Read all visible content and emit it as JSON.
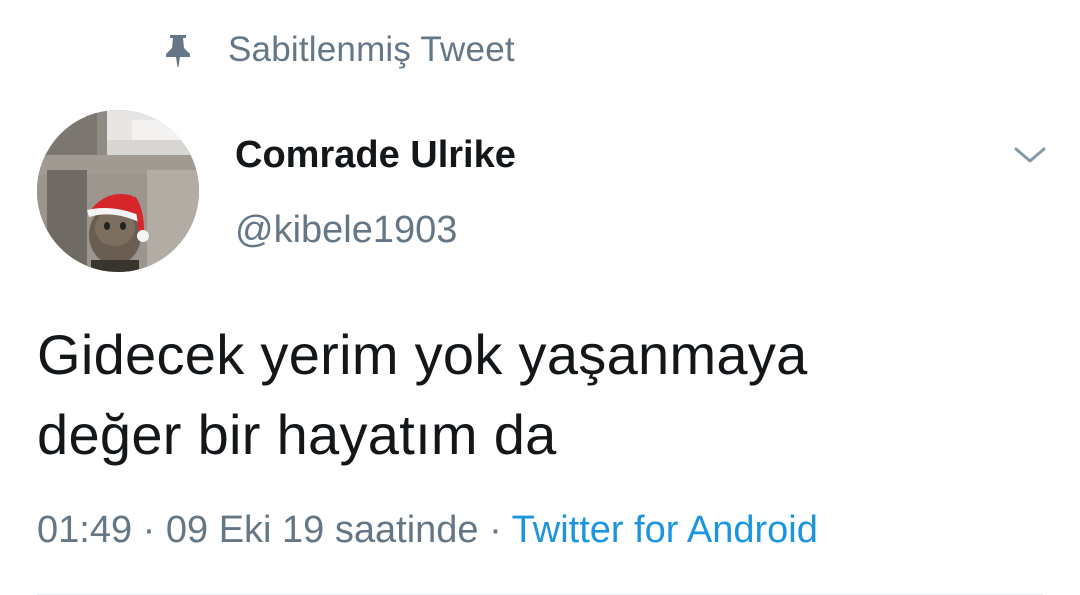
{
  "pinned": {
    "label": "Sabitlenmiş Tweet",
    "icon": "pin-icon"
  },
  "author": {
    "display_name": "Comrade Ulrike",
    "handle": "@kibele1903"
  },
  "caret_icon": "chevron-down-icon",
  "tweet": {
    "text_line1": "Gidecek yerim yok yaşanmaya",
    "text_line2": "değer bir hayatım da"
  },
  "meta": {
    "time": "01:49",
    "separator": " · ",
    "date": "09 Eki 19 saatinde",
    "source": "Twitter for Android"
  },
  "colors": {
    "text_primary": "#14171a",
    "text_secondary": "#657786",
    "link": "#1b95e0",
    "divider": "#e6ecf0"
  }
}
